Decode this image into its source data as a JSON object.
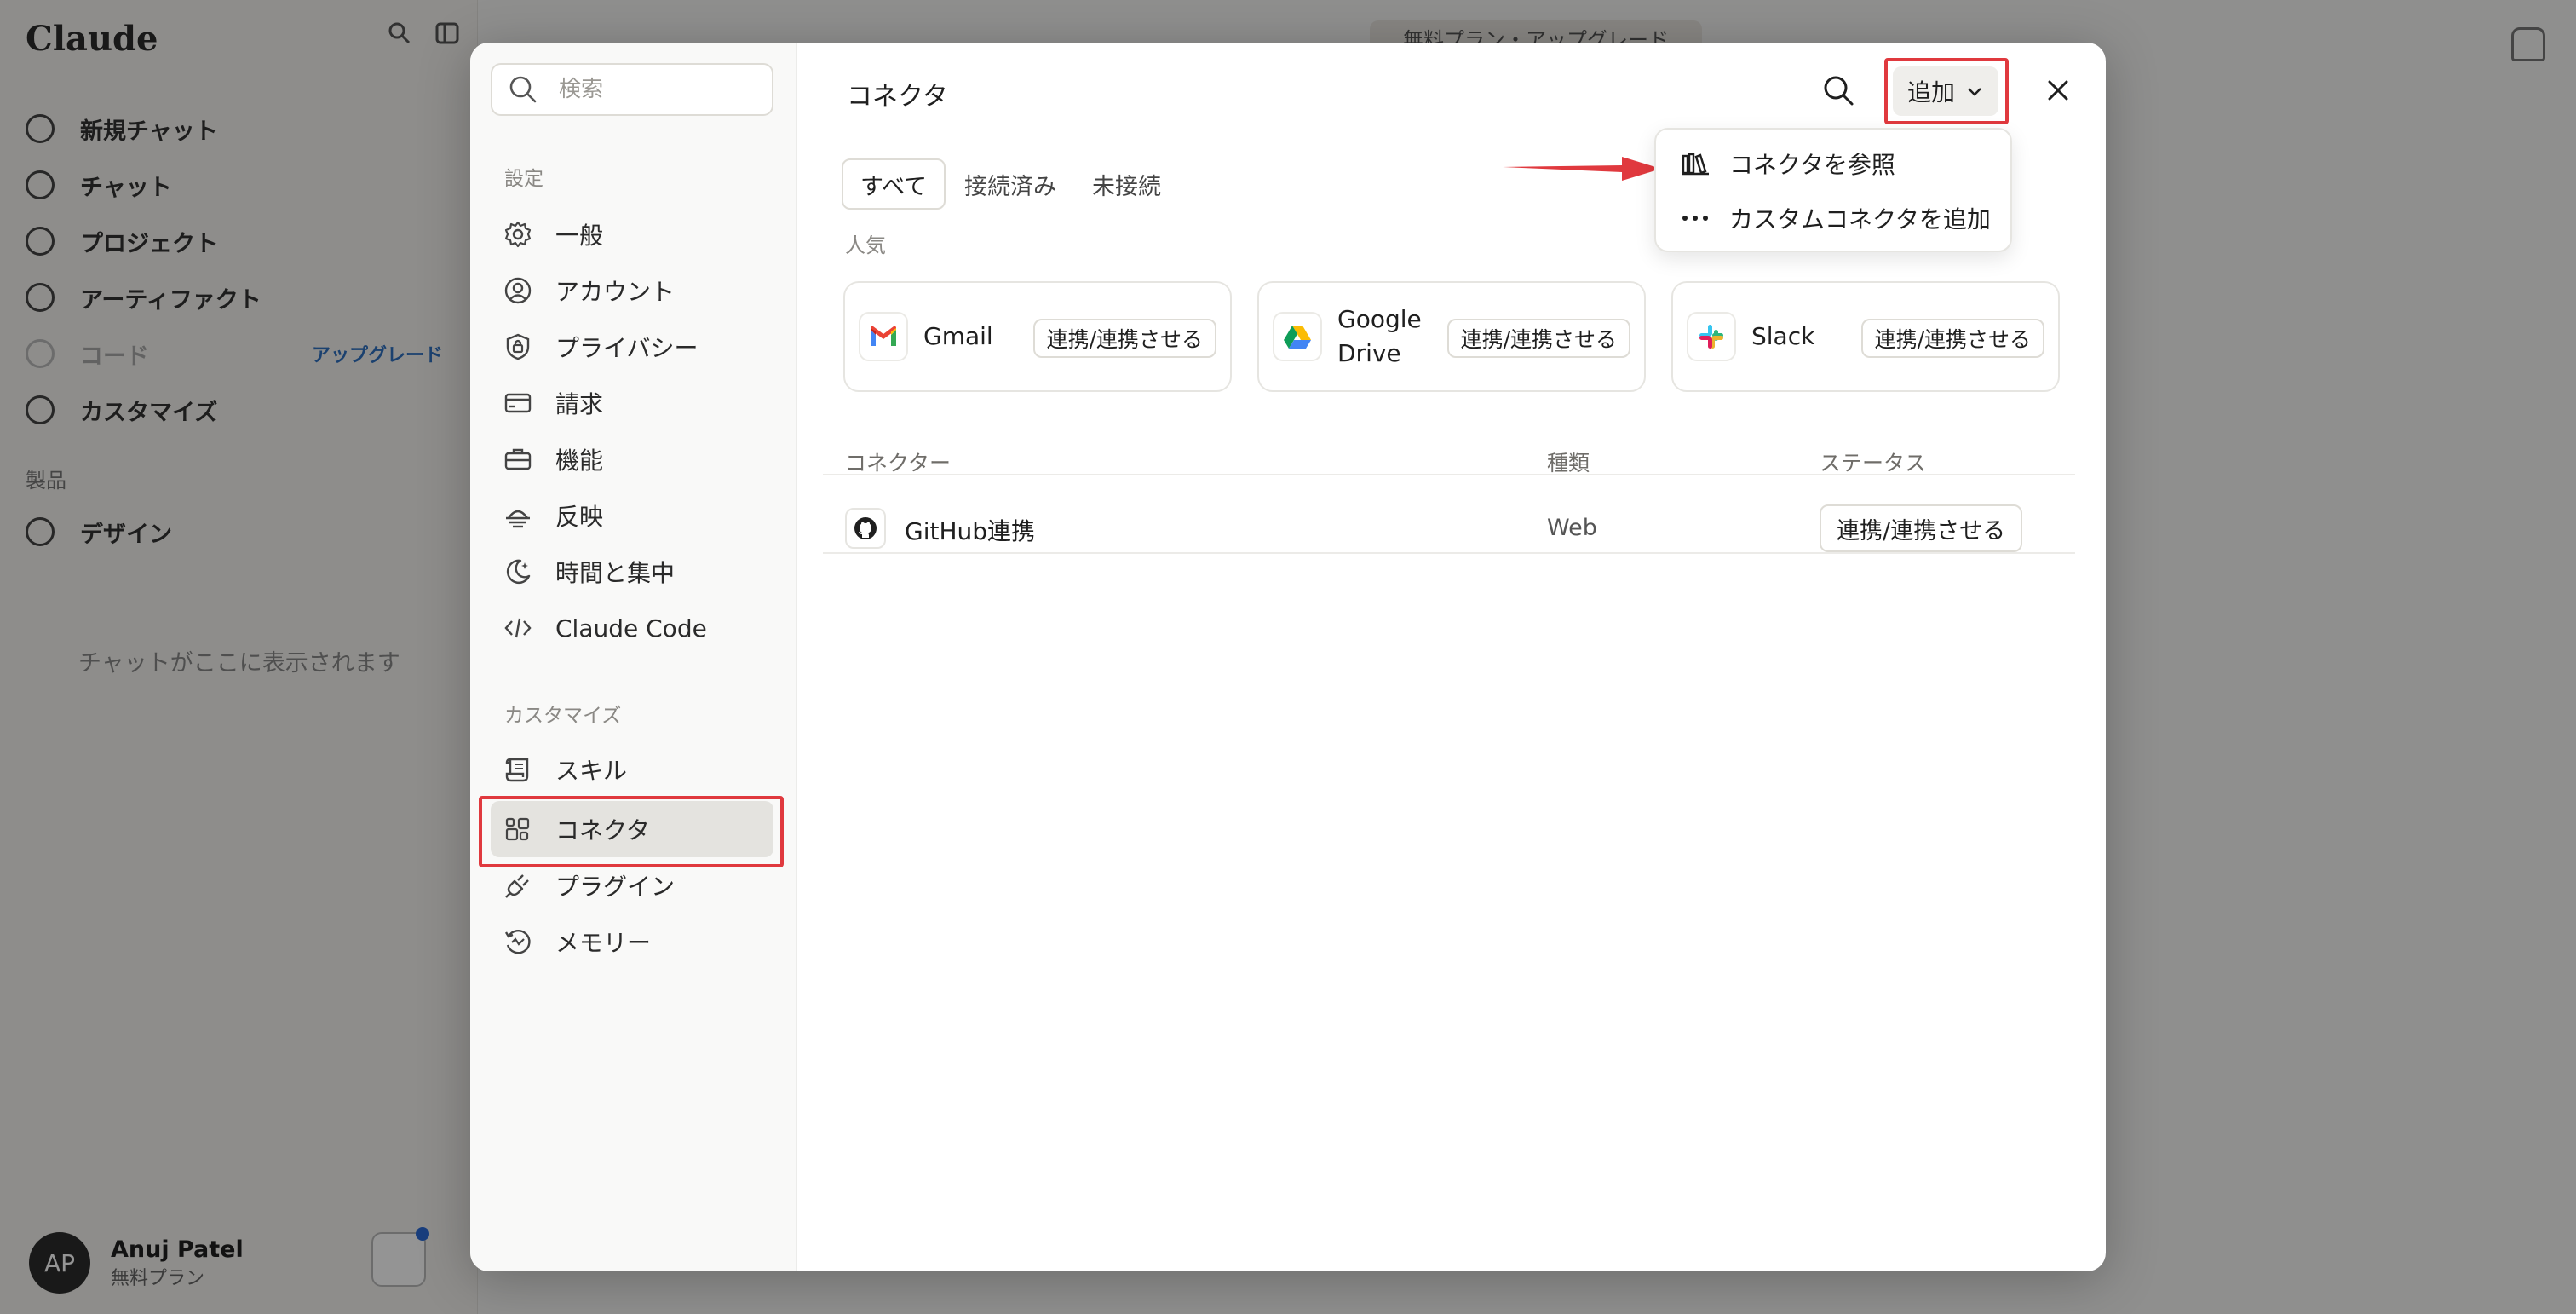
{
  "background_app": {
    "logo": "Claude",
    "nav": [
      {
        "label": "新規チャット",
        "icon": "plus-circle-icon"
      },
      {
        "label": "チャット",
        "icon": "chat-icon"
      },
      {
        "label": "プロジェクト",
        "icon": "folder-icon"
      },
      {
        "label": "アーティファクト",
        "icon": "artifact-icon"
      },
      {
        "label": "コード",
        "icon": "code-icon",
        "badge": "アップグレード"
      },
      {
        "label": "カスタマイズ",
        "icon": "briefcase-icon"
      }
    ],
    "section_label": "製品",
    "section_items": [
      {
        "label": "デザイン",
        "icon": "palette-icon"
      }
    ],
    "empty_text": "チャットがここに表示されます",
    "upgrade_banner": "無料プラン・アップグレード",
    "user": {
      "initials": "AP",
      "name": "Anuj Patel",
      "plan": "無料プラン"
    }
  },
  "modal": {
    "search_placeholder": "検索",
    "settings_label": "設定",
    "settings_items": [
      {
        "label": "一般",
        "icon": "gear-icon"
      },
      {
        "label": "アカウント",
        "icon": "user-circle-icon"
      },
      {
        "label": "プライバシー",
        "icon": "shield-lock-icon"
      },
      {
        "label": "請求",
        "icon": "credit-card-icon"
      },
      {
        "label": "機能",
        "icon": "toolbox-icon"
      },
      {
        "label": "反映",
        "icon": "sunset-icon"
      },
      {
        "label": "時間と集中",
        "icon": "moon-icon"
      },
      {
        "label": "Claude Code",
        "icon": "code-brackets-icon"
      }
    ],
    "customize_label": "カスタマイズ",
    "customize_items": [
      {
        "label": "スキル",
        "icon": "scroll-icon"
      },
      {
        "label": "コネクタ",
        "icon": "connector-grid-icon",
        "active": true
      },
      {
        "label": "プラグイン",
        "icon": "plug-icon"
      },
      {
        "label": "メモリー",
        "icon": "history-icon"
      }
    ],
    "title": "コネクタ",
    "add_button": "追加",
    "tabs": [
      {
        "label": "すべて",
        "active": true
      },
      {
        "label": "接続済み",
        "active": false
      },
      {
        "label": "未接続",
        "active": false
      }
    ],
    "popular_label": "人気",
    "popular": [
      {
        "name": "Gmail",
        "icon": "gmail-icon",
        "button": "連携/連携させる"
      },
      {
        "name": "Google Drive",
        "icon": "google-drive-icon",
        "button": "連携/連携させる"
      },
      {
        "name": "Slack",
        "icon": "slack-icon",
        "button": "連携/連携させる"
      }
    ],
    "table": {
      "headers": [
        "コネクター",
        "種類",
        "ステータス"
      ],
      "rows": [
        {
          "name": "GitHub連携",
          "type": "Web",
          "status_button": "連携/連携させる",
          "icon": "github-icon"
        }
      ]
    },
    "dropdown": [
      {
        "label": "コネクタを参照",
        "icon": "library-icon"
      },
      {
        "label": "カスタムコネクタを追加",
        "icon": "ellipsis-icon"
      }
    ]
  },
  "colors": {
    "highlight": "#e0393e",
    "overlay": "rgba(0,0,0,0.42)",
    "active_item_bg": "#e4e3df"
  }
}
